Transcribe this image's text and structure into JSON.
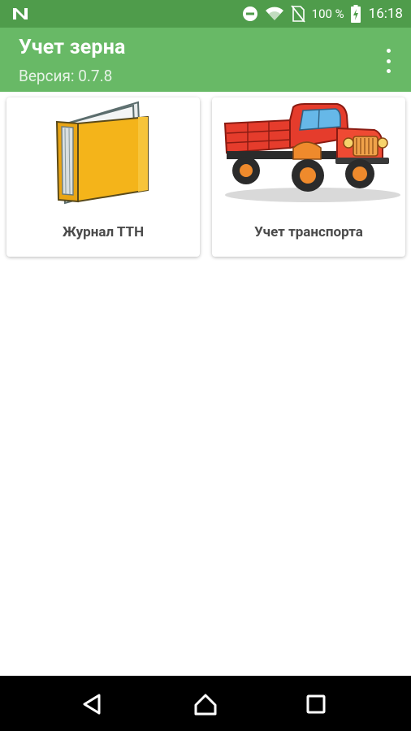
{
  "status_bar": {
    "battery_percent": "100 %",
    "time": "16:18",
    "icons": [
      "n-logo-icon",
      "dnd-icon",
      "wifi-icon",
      "no-sim-icon",
      "battery-charging-icon"
    ]
  },
  "app_bar": {
    "title": "Учет зерна",
    "subtitle": "Версия: 0.7.8",
    "menu_icon": "more-vert-icon"
  },
  "cards": [
    {
      "label": "Журнал ТТН",
      "icon": "folder-icon"
    },
    {
      "label": "Учет транспорта",
      "icon": "truck-icon"
    }
  ],
  "nav_bar": {
    "icons": [
      "back-icon",
      "home-icon",
      "recents-icon"
    ]
  },
  "colors": {
    "status_bar": "#4f9c4b",
    "app_bar": "#68b966",
    "nav_bar": "#000000"
  }
}
